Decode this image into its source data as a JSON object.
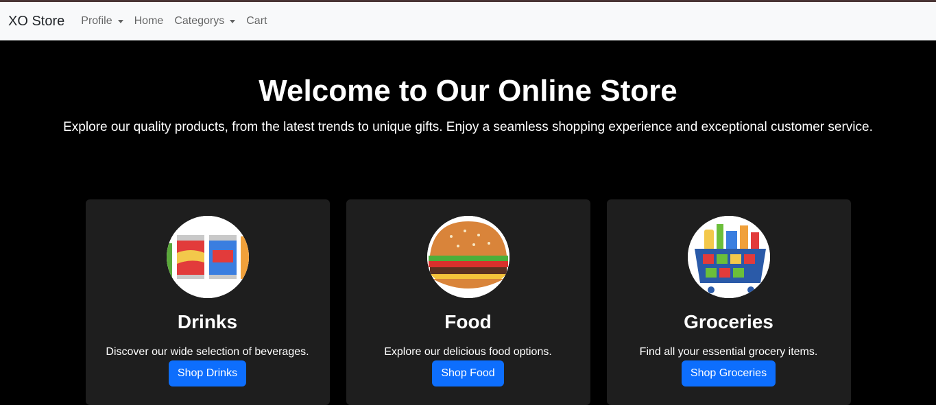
{
  "nav": {
    "brand": "XO Store",
    "items": [
      {
        "label": "Profile",
        "dropdown": true
      },
      {
        "label": "Home",
        "dropdown": false
      },
      {
        "label": "Categorys",
        "dropdown": true
      },
      {
        "label": "Cart",
        "dropdown": false
      }
    ]
  },
  "hero": {
    "title": "Welcome to Our Online Store",
    "subtitle": "Explore our quality products, from the latest trends to unique gifts. Enjoy a seamless shopping experience and exceptional customer service."
  },
  "cards": [
    {
      "title": "Drinks",
      "description": "Discover our wide selection of beverages.",
      "button": "Shop Drinks",
      "image": "soda-cans-icon"
    },
    {
      "title": "Food",
      "description": "Explore our delicious food options.",
      "button": "Shop Food",
      "image": "burger-icon"
    },
    {
      "title": "Groceries",
      "description": "Find all your essential grocery items.",
      "button": "Shop Groceries",
      "image": "grocery-basket-icon"
    }
  ],
  "colors": {
    "primary": "#0d6efd",
    "card_bg": "#1e1e1e",
    "navbar_bg": "#f8f9fa"
  }
}
